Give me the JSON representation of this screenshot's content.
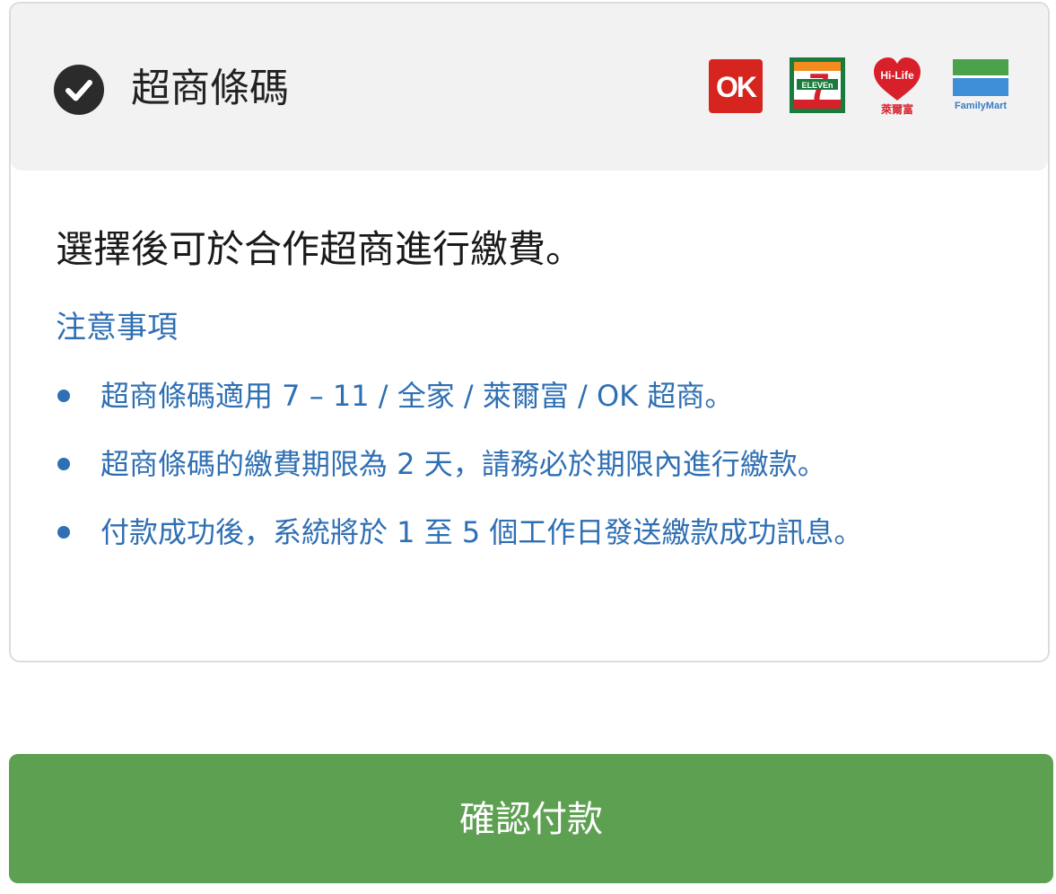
{
  "payment_option": {
    "title": "超商條碼",
    "selected": true,
    "logos": [
      {
        "name": "OK",
        "icon": "ok-mart-logo",
        "color": "#d6241f"
      },
      {
        "name": "7-ELEVEn",
        "icon": "seven-eleven-logo",
        "color": "#1b7a3e"
      },
      {
        "name": "Hi-Life 萊爾富",
        "icon": "hilife-logo",
        "color": "#d8202b"
      },
      {
        "name": "FamilyMart",
        "icon": "familymart-logo",
        "color": "#3a7cc3"
      }
    ],
    "logo_texts": {
      "ok": "OK",
      "seven_eleven": "ELEVEn",
      "seven": "7",
      "hilife": "Hi-Life",
      "hilife_cn": "萊爾富",
      "familymart": "FamilyMart"
    }
  },
  "description": "選擇後可於合作超商進行繳費。",
  "notice": {
    "title": "注意事項",
    "items": [
      "超商條碼適用 7 – 11 / 全家 / 萊爾富 / OK 超商。",
      "超商條碼的繳費期限為 2 天，請務必於期限內進行繳款。",
      "付款成功後，系統將於 1 至 5 個工作日發送繳款成功訊息。"
    ]
  },
  "confirm_button_label": "確認付款",
  "colors": {
    "accent_blue": "#2f6fb3",
    "button_green": "#5ea052",
    "header_bg": "#f2f2f2"
  }
}
